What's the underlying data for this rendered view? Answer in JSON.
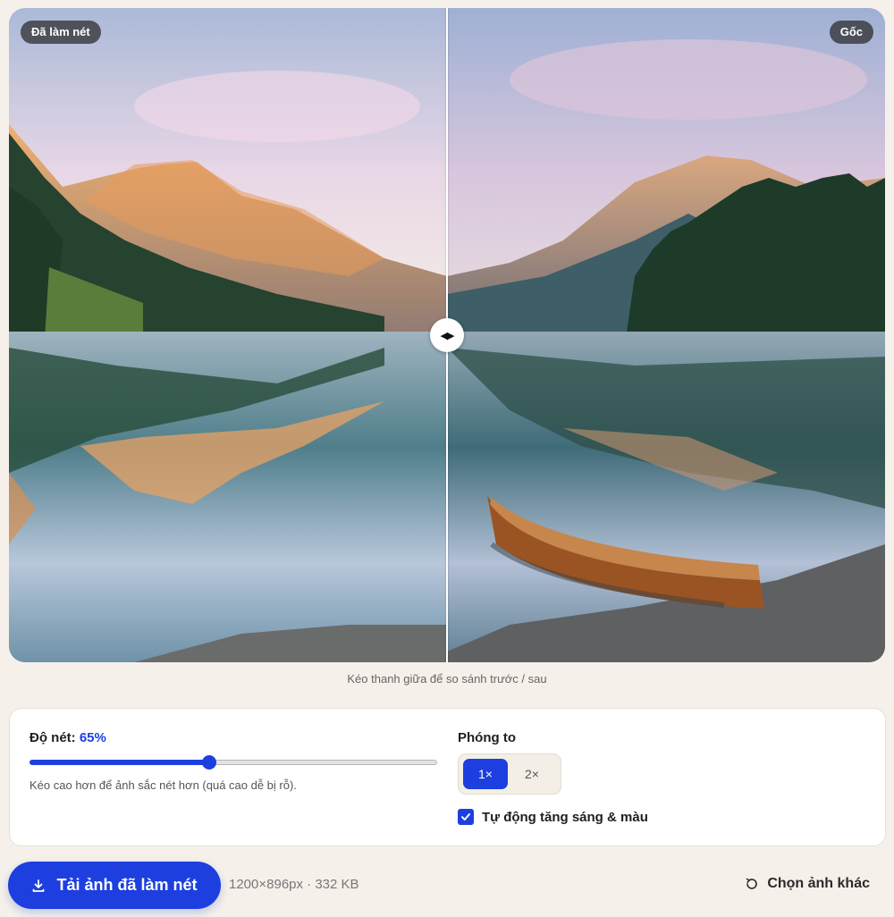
{
  "compare": {
    "enhanced_badge": "Đã làm nét",
    "original_badge": "Gốc",
    "handle_glyph": "◀▶",
    "hint": "Kéo thanh giữa để so sánh trước / sau"
  },
  "controls": {
    "sharpness_label": "Độ nét:",
    "sharpness_value_text": "65%",
    "sharpness_slider_fraction": 0.44,
    "sharpness_help": "Kéo cao hơn để ảnh sắc nét hơn (quá cao dễ bị rỗ).",
    "zoom_label": "Phóng to",
    "zoom_options": [
      "1×",
      "2×"
    ],
    "zoom_selected": "1×",
    "auto_enhance_label": "Tự động tăng sáng & màu",
    "auto_enhance_checked": true
  },
  "footer": {
    "download_label": "Tải ảnh đã làm nét",
    "file_meta": "1200×896px · 332 KB",
    "choose_other_label": "Chọn ảnh khác"
  },
  "colors": {
    "accent": "#1d3fe0",
    "background": "#f5f1ea"
  },
  "icons": {
    "download": "download-icon",
    "refresh": "refresh-icon",
    "check": "check-icon"
  }
}
